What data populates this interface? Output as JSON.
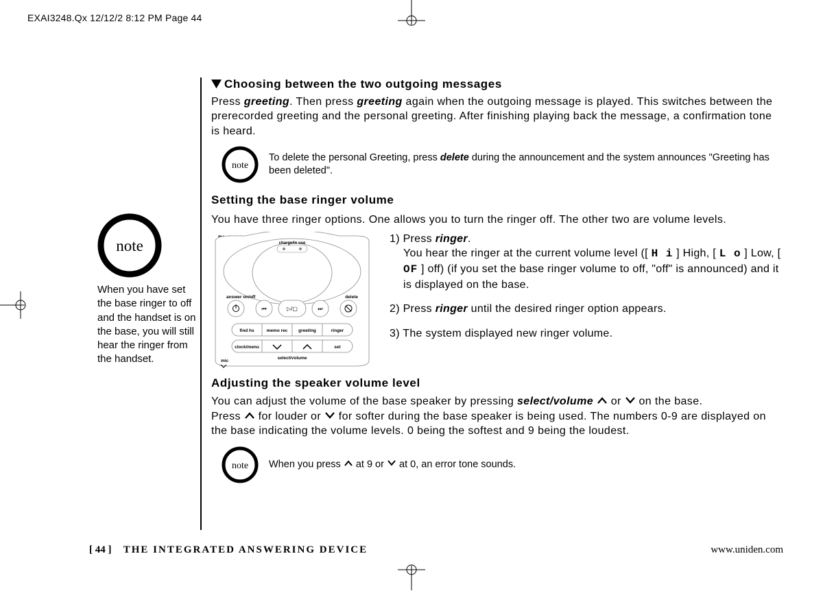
{
  "header": {
    "filestamp": "EXAI3248.Qx  12/12/2 8:12 PM  Page 44"
  },
  "main": {
    "choosing": {
      "title": "Choosing between the two outgoing messages",
      "p1a": "Press ",
      "p1b": "greeting",
      "p1c": ". Then press ",
      "p1d": "greeting",
      "p1e": " again when the outgoing message is played. This switches between the prerecorded greeting and the personal greeting. After finishing playing back the message, a confirmation tone is heard.",
      "note1a": "To delete the personal Greeting, press ",
      "note1b": "delete",
      "note1c": " during the announcement and the system announces \"Greeting has been deleted\"."
    },
    "ringer": {
      "title": "Setting the base ringer volume",
      "intro": "You have three ringer options. One allows you to turn the ringer off. The other two are volume levels.",
      "step1_a": "1) Press ",
      "step1_b": "ringer",
      "step1_c": ".",
      "step1_d": "You hear the ringer at the current volume level ([",
      "step1_hi": "H i",
      "step1_e": "] High, [",
      "step1_lo": "L o",
      "step1_f": "] Low, [",
      "step1_of": "OF",
      "step1_g": "] off) (if you set the base ringer volume to off, \"off\" is announced) and it is displayed on the base.",
      "step2_a": "2) Press ",
      "step2_b": "ringer",
      "step2_c": " until the desired ringer option appears.",
      "step3": "3) The system displayed new ringer volume."
    },
    "speaker": {
      "title": "Adjusting the speaker volume level",
      "p1a": "You can adjust the volume of the base speaker by pressing ",
      "p1b": "select/volume",
      "p1c": "  or  ",
      "p1d": " on the base.",
      "p2a": "Press ",
      "p2b": " for louder or ",
      "p2c": " for softer during the base speaker is being used. The numbers 0-9 are displayed on the base indicating the volume levels. 0 being the softest and 9 being the loudest.",
      "note2a": "When you press ",
      "note2b": " at 9 or ",
      "note2c": " at 0, an error tone sounds."
    }
  },
  "sidebar": {
    "note": "When you have set the base ringer to off and the handset is on the base, you will still hear the ringer from the handset."
  },
  "diagram": {
    "title": "Digital Answerer",
    "charge": "charge/in use",
    "answer": "answer on/off",
    "delete": "delete",
    "findhs": "find hs",
    "memo": "memo rec",
    "greeting": "greeting",
    "ringer": "ringer",
    "clock": "clock/menu",
    "set": "set",
    "selvol": "select/volume",
    "mic": "mic"
  },
  "footer": {
    "page": "[ 44 ]",
    "title": "THE INTEGRATED ANSWERING DEVICE",
    "url": "www.uniden.com"
  }
}
